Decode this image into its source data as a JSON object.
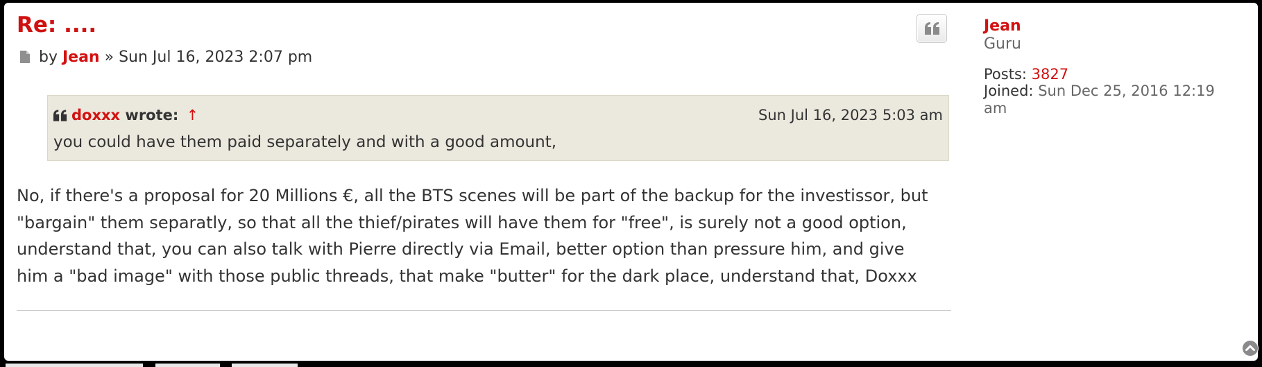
{
  "post": {
    "title": "Re: ....",
    "by_label": "by",
    "author": "Jean",
    "separator": "»",
    "date": "Sun Jul 16, 2023 2:07 pm",
    "quote_button_icon": "quote-icon",
    "blockquote": {
      "author": "doxxx",
      "wrote_label": "wrote:",
      "jump_arrow": "↑",
      "date": "Sun Jul 16, 2023 5:03 am",
      "text": "you could have them paid separately and with a good amount,"
    },
    "body_lines": [
      "No, if there's a proposal for 20 Millions €, all the BTS scenes will be part of the backup for the investissor, but",
      "\"bargain\" them separatly, so that all the thief/pirates will have them for \"free\", is surely not a good option,",
      "understand that, you can also talk with Pierre directly via Email, better option than pressure him, and give",
      "him a \"bad image\" with those public threads, that make \"butter\" for the dark place, understand that, Doxxx"
    ]
  },
  "profile": {
    "name": "Jean",
    "rank": "Guru",
    "posts_label": "Posts:",
    "posts_value": "3827",
    "joined_label": "Joined:",
    "joined_value": "Sun Dec 25, 2016 12:19 am"
  },
  "icons": {
    "post": "file-icon",
    "quote": "quote-icon",
    "back_to_top": "circle-chevron-up-icon"
  },
  "colors": {
    "link": "#d31111",
    "text": "#333333",
    "quote_bg": "#ebe9de",
    "panel_bg": "#ffffff"
  }
}
